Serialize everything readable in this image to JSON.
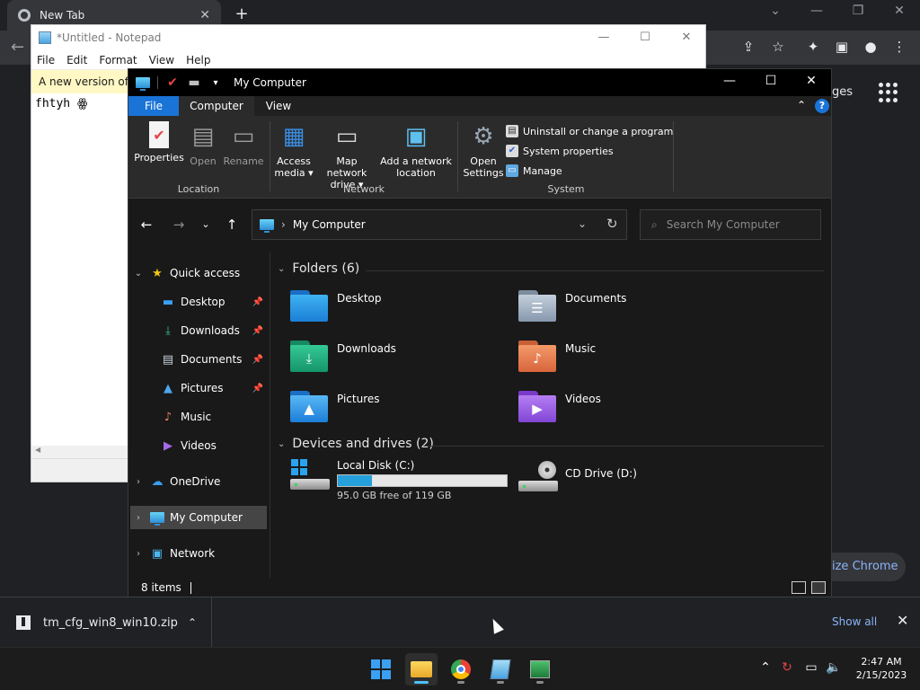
{
  "chrome": {
    "tab_title": "New Tab",
    "images_link": "ages",
    "customize_label": "ize Chrome",
    "colors": {
      "background": "#202124",
      "toolbar": "#35363a",
      "link": "#8ab4f8"
    }
  },
  "notepad": {
    "title": "*Untitled - Notepad",
    "menu": [
      "File",
      "Edit",
      "Format",
      "View",
      "Help"
    ],
    "notice": "A new version of N",
    "text": "fhtyh ꙮ"
  },
  "explorer": {
    "title": "My Computer",
    "tabs": {
      "file": "File",
      "computer": "Computer",
      "view": "View"
    },
    "ribbon": {
      "location": {
        "label": "Location",
        "properties": "Properties",
        "open": "Open",
        "rename": "Rename"
      },
      "network": {
        "label": "Network",
        "access_media": [
          "Access",
          "media ▾"
        ],
        "map_network_drive": [
          "Map network",
          "drive ▾"
        ],
        "add_network_location": [
          "Add a network",
          "location"
        ]
      },
      "system": {
        "label": "System",
        "open_settings": [
          "Open",
          "Settings"
        ],
        "uninstall": "Uninstall or change a program",
        "system_properties": "System properties",
        "manage": "Manage"
      }
    },
    "address": {
      "crumb": "My Computer"
    },
    "search": {
      "placeholder": "Search My Computer"
    },
    "nav": {
      "quick_access": "Quick access",
      "desktop": "Desktop",
      "downloads": "Downloads",
      "documents": "Documents",
      "pictures": "Pictures",
      "music": "Music",
      "videos": "Videos",
      "onedrive": "OneDrive",
      "my_computer": "My Computer",
      "network": "Network"
    },
    "folders_header": "Folders (6)",
    "folders": {
      "desktop": "Desktop",
      "documents": "Documents",
      "downloads": "Downloads",
      "music": "Music",
      "pictures": "Pictures",
      "videos": "Videos"
    },
    "drives_header": "Devices and drives (2)",
    "drives": {
      "c_label": "Local Disk (C:)",
      "c_free": "95.0 GB free of 119 GB",
      "c_used_fraction": 0.2,
      "d_label": "CD Drive (D:)"
    },
    "status": "8 items",
    "colors": {
      "accent": "#1a74d8",
      "capacity": "#26a0da",
      "background": "#191919"
    }
  },
  "downloads_bar": {
    "file": "tm_cfg_win8_win10.zip",
    "show_all": "Show all"
  },
  "taskbar": {
    "time": "2:47 AM",
    "date": "2/15/2023"
  }
}
